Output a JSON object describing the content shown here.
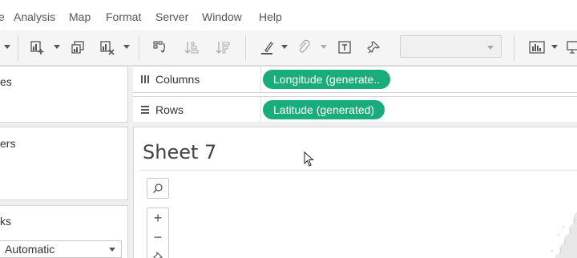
{
  "menubar": {
    "items": [
      {
        "label": "e"
      },
      {
        "label": "Analysis"
      },
      {
        "label": "Map"
      },
      {
        "label": "Format"
      },
      {
        "label": "Server"
      },
      {
        "label": "Window"
      },
      {
        "label": "Help"
      }
    ]
  },
  "toolbar": {
    "buttons": [
      {
        "icon": "new-worksheet-icon"
      },
      {
        "icon": "duplicate-sheet-icon"
      },
      {
        "icon": "clear-sheet-icon"
      },
      {
        "icon": "swap-rows-columns-icon"
      },
      {
        "icon": "sort-ascending-icon"
      },
      {
        "icon": "sort-descending-icon"
      },
      {
        "icon": "highlight-icon"
      },
      {
        "icon": "group-members-icon"
      },
      {
        "icon": "show-mark-labels-icon"
      },
      {
        "icon": "pin-axes-icon"
      },
      {
        "icon": "show-me-icon"
      },
      {
        "icon": "presentation-mode-icon"
      }
    ],
    "fit_combo_value": ""
  },
  "left_panels": {
    "pages_label": "es",
    "filters_label": "ers",
    "marks_label": "ks",
    "marks_type_value": "Automatic"
  },
  "shelves": {
    "columns": {
      "label": "Columns",
      "pill": "Longitude (generate.."
    },
    "rows": {
      "label": "Rows",
      "pill": "Latitude (generated)"
    }
  },
  "sheet": {
    "title": "Sheet 7"
  },
  "map_controls": {
    "search_icon": "search-icon",
    "zoom_in": "+",
    "zoom_out": "−",
    "pin_icon": "pin-icon"
  },
  "colors": {
    "pill_green": "#1aad7c",
    "toolbar_bg": "#f5f5f5",
    "panel_border": "#d4d4d4"
  }
}
